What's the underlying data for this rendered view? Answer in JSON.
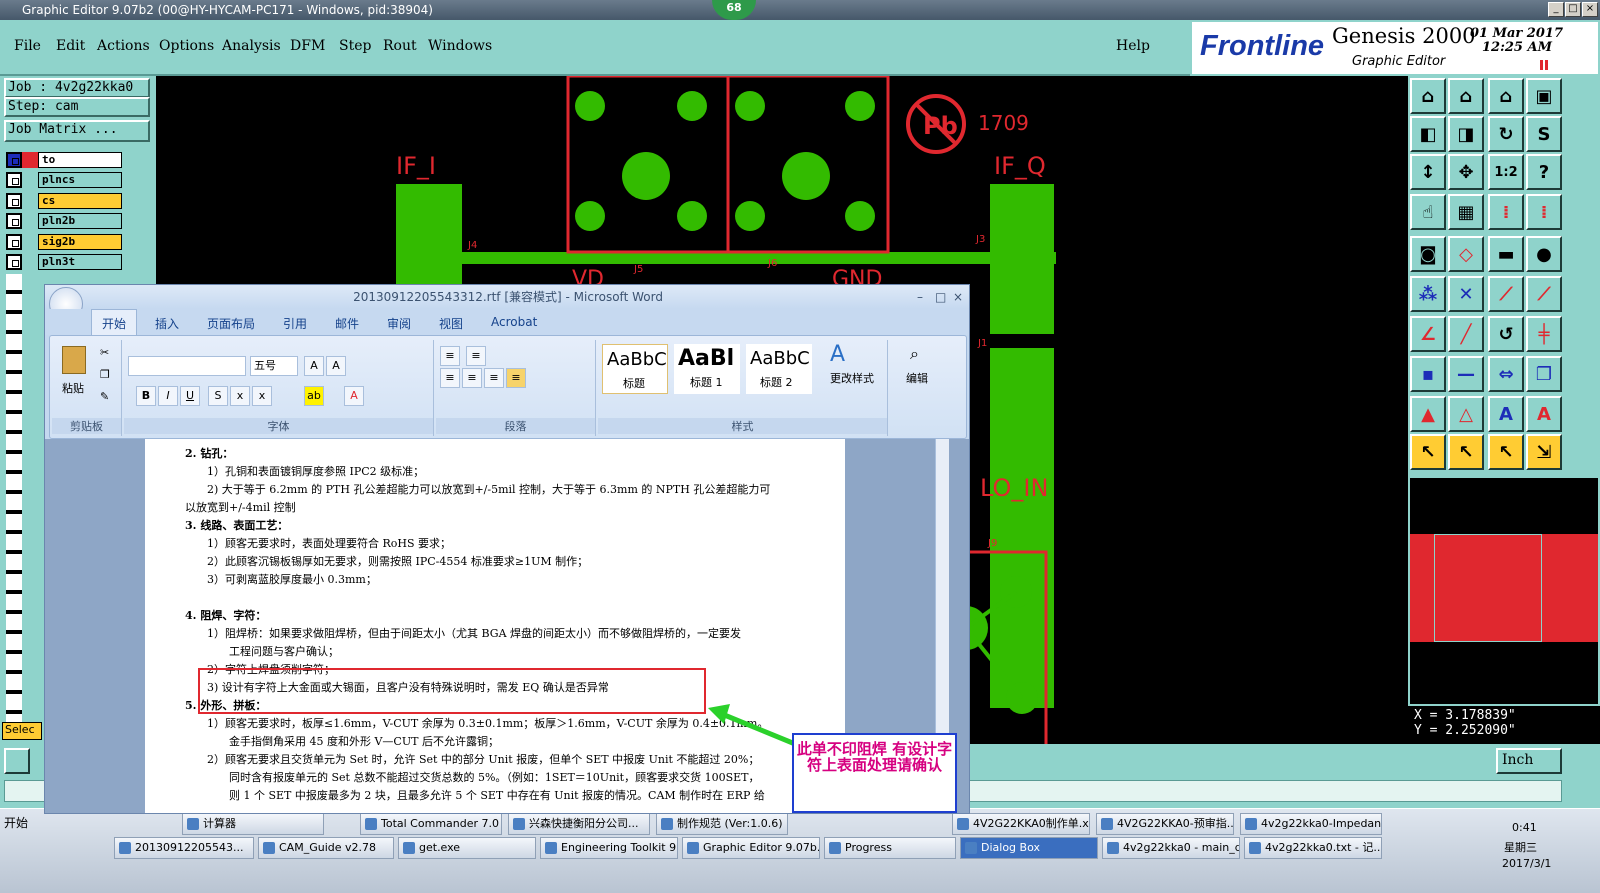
{
  "window": {
    "title": "Graphic Editor 9.07b2 (00@HY-HYCAM-PC171 - Windows, pid:38904)",
    "badge": "68"
  },
  "menu": [
    "File",
    "Edit",
    "Actions",
    "Options",
    "Analysis",
    "DFM",
    "Step",
    "Rout",
    "Windows"
  ],
  "help": "Help",
  "brand": {
    "logo": "Frontline",
    "product": "Genesis 2000",
    "sub": "Graphic Editor",
    "date": "01 Mar 2017",
    "time": "12:25 AM"
  },
  "job": {
    "job": "Job : 4v2g22kka0",
    "step": "Step: cam",
    "matrix": "Job Matrix ..."
  },
  "layers": [
    {
      "name": "to",
      "state": "white"
    },
    {
      "name": "plncs",
      "state": "off"
    },
    {
      "name": "cs",
      "state": "on"
    },
    {
      "name": "pln2b",
      "state": "off"
    },
    {
      "name": "sig2b",
      "state": "on"
    },
    {
      "name": "pln3t",
      "state": "off"
    }
  ],
  "select_label": "Selec",
  "canvas": {
    "labels": [
      "IF_I",
      "IF_Q",
      "LO_IN",
      "VD",
      "GND",
      "J4",
      "J5",
      "J6",
      "J3",
      "J1",
      "J9",
      "B"
    ],
    "pb_mark": "Pb",
    "code": "1709"
  },
  "coords": {
    "x": "X = 3.178839\"",
    "y": "Y = 2.252090\""
  },
  "units": "Inch",
  "word": {
    "title": "20130912205543312.rtf [兼容模式] - Microsoft Word",
    "tabs": [
      "开始",
      "插入",
      "页面布局",
      "引用",
      "邮件",
      "审阅",
      "视图",
      "Acrobat"
    ],
    "groups": {
      "clipboard": "剪贴板",
      "font": "字体",
      "paragraph": "段落",
      "styles": "样式",
      "edit": "编辑"
    },
    "paste": "粘贴",
    "fontsize": "五号",
    "styles": [
      {
        "sample": "AaBbC",
        "name": "标题"
      },
      {
        "sample": "AaBl",
        "name": "标题 1"
      },
      {
        "sample": "AaBbC",
        "name": "标题 2"
      }
    ],
    "change_styles": "更改样式",
    "edit_label": "编辑",
    "lines": [
      "2.  钻孔：",
      "1）孔铜和表面镀铜厚度参照 IPC2 级标准；",
      "2) 大于等于 6.2mm 的 PTH 孔公差超能力可以放宽到+/-5mil 控制，大于等于 6.3mm 的 NPTH 孔公差超能力可",
      "以放宽到+/-4mil 控制",
      "3.  线路、表面工艺：",
      "1）顾客无要求时，表面处理要符合 RoHS 要求；",
      "2）此顾客沉锡板锡厚如无要求，则需按照 IPC-4554 标准要求≥1UM 制作；",
      "3）可剥离蓝胶厚度最小 0.3mm；",
      "4.  阻焊、字符：",
      "1）阻焊桥：如果要求做阻焊桥，但由于间距太小（尤其 BGA 焊盘的间距太小）而不够做阻焊桥的，一定要发",
      "工程问题与客户确认；",
      "2）字符上焊盘须削字符；",
      "3) 设计有字符上大金面或大锡面，且客户没有特殊说明时，需发 EQ 确认是否异常",
      "5.  外形、拼板：",
      "1）顾客无要求时，板厚≤1.6mm，V-CUT 余厚为 0.3±0.1mm；板厚＞1.6mm，V-CUT 余厚为 0.4±0.1mm。",
      "金手指倒角采用 45 度和外形 V—CUT 后不允许露铜；",
      "2）顾客无要求且交货单元为 Set 时，允许 Set 中的部分 Unit 报废，但单个 SET 中报废 Unit 不能超过 20%；",
      "同时含有报废单元的 Set 总数不能超过交货总数的 5%。（例如：1SET＝10Unit，顾客要求交货 100SET，",
      "则 1 个 SET 中报废最多为 2 块，且最多允许 5 个 SET 中存在有 Unit 报废的情况。CAM 制作时在 ERP 给"
    ]
  },
  "callout": "此单不印阻焊  有设计字符上表面处理请确认",
  "taskbar": {
    "start": "开始",
    "row1": [
      "计算器",
      "Total Commander 7.0 ...",
      "兴森快捷衡阳分公司...",
      "制作规范 (Ver:1.0.6)",
      "4V2G22KKA0制作单.x...",
      "4V2G22KKA0-预审指...",
      "4v2g22kka0-Impedan..."
    ],
    "row2": [
      "20130912205543...",
      "CAM_Guide v2.78",
      "get.exe",
      "Engineering Toolkit 9....",
      "Graphic Editor 9.07b...",
      "Progress",
      "Dialog Box",
      "4v2g22kka0 - main_qa",
      "4v2g22kka0.txt - 记..."
    ],
    "clock": "0:41",
    "weekday": "星期三",
    "date": "2017/3/1"
  },
  "colors": {
    "panel": "#8fd3cb",
    "trace": "#33bb00",
    "outline": "#e0282f",
    "callout_text": "#d60080"
  }
}
